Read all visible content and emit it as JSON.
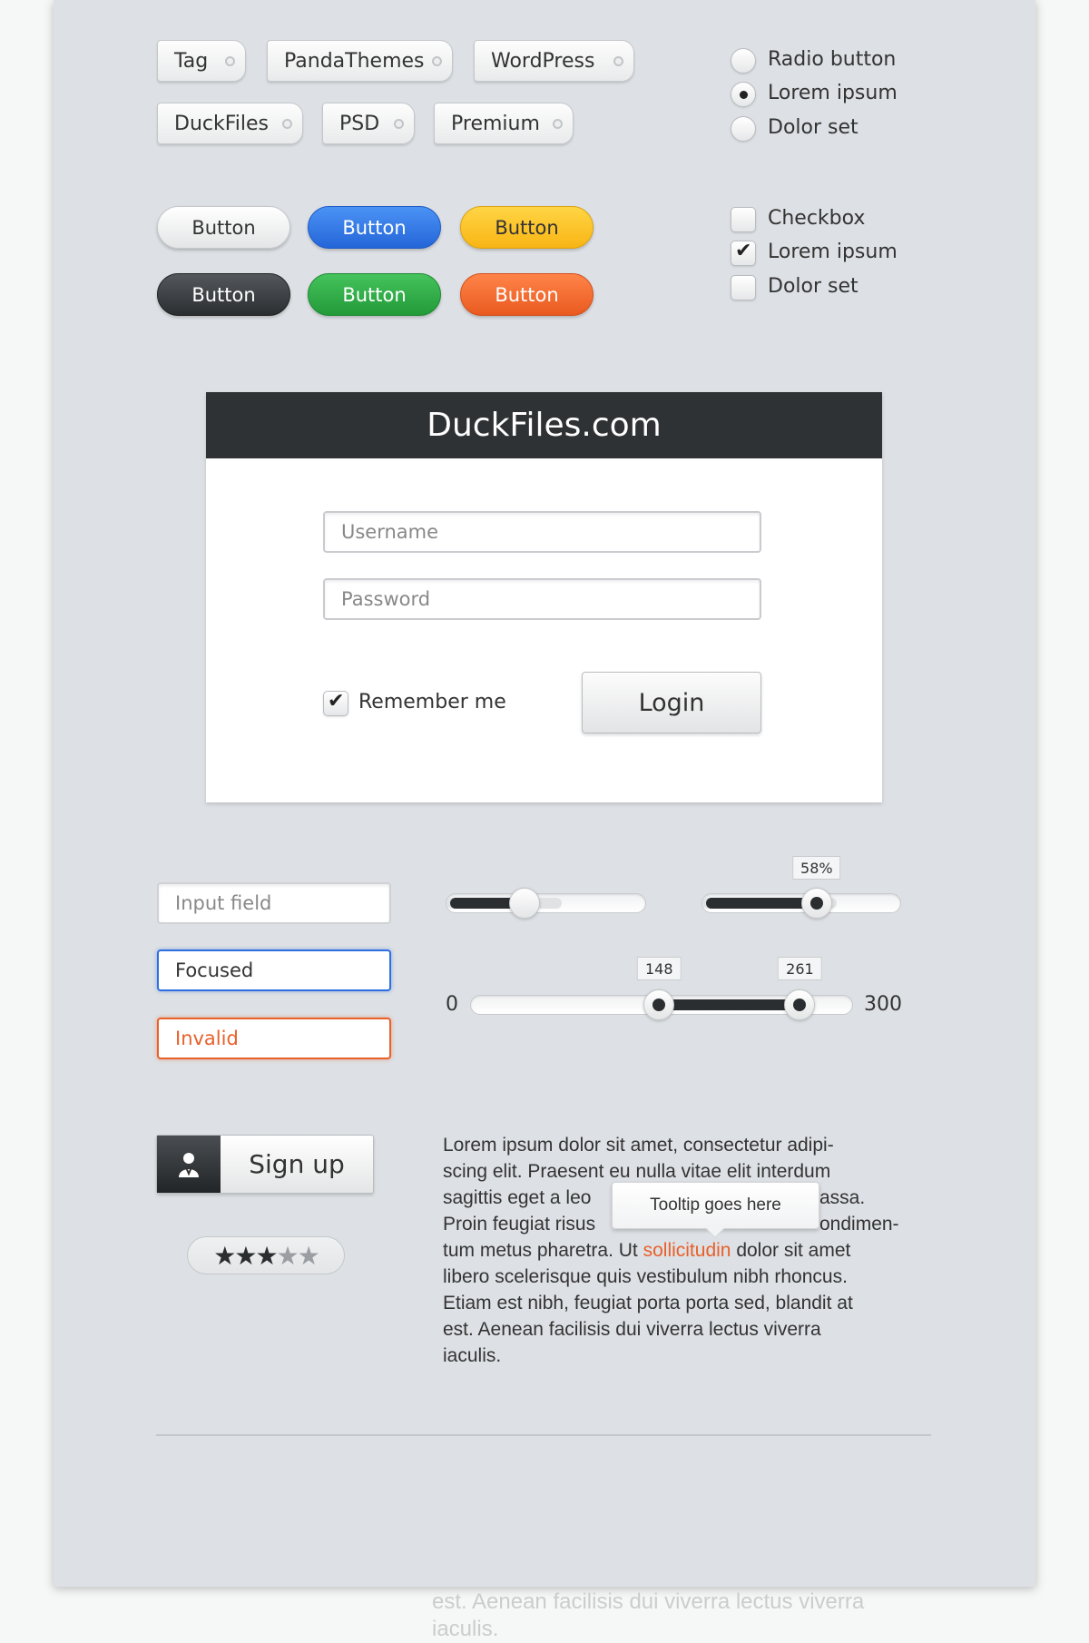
{
  "tags": [
    "Tag",
    "PandaThemes",
    "WordPress",
    "DuckFiles",
    "PSD",
    "Premium"
  ],
  "radios": {
    "items": [
      "Radio button",
      "Lorem ipsum",
      "Dolor set"
    ],
    "selected": 1
  },
  "checkboxes": {
    "items": [
      "Checkbox",
      "Lorem ipsum",
      "Dolor set"
    ],
    "checked": [
      false,
      true,
      false
    ]
  },
  "buttons": [
    {
      "label": "Button",
      "color": "#f2f2f2"
    },
    {
      "label": "Button",
      "color": "#2f7be8"
    },
    {
      "label": "Button",
      "color": "#fcc52a"
    },
    {
      "label": "Button",
      "color": "#3a3d40"
    },
    {
      "label": "Button",
      "color": "#2eac45"
    },
    {
      "label": "Button",
      "color": "#f2692a"
    }
  ],
  "login": {
    "title": "DuckFiles.com",
    "username_placeholder": "Username",
    "password_placeholder": "Password",
    "remember_label": "Remember me",
    "remember_checked": true,
    "login_label": "Login"
  },
  "inputs": {
    "default_placeholder": "Input field",
    "focused_value": "Focused",
    "invalid_value": "Invalid",
    "focus_color": "#2f6fe0",
    "invalid_color": "#e8602a"
  },
  "sliders": {
    "slider1_percent": 39,
    "slider2_percent": 58,
    "slider2_label": "58%",
    "range": {
      "min_label": "0",
      "max_label": "300",
      "min": 0,
      "max": 300,
      "low": 148,
      "high": 261,
      "low_label": "148",
      "high_label": "261"
    }
  },
  "signup": {
    "label": "Sign up",
    "icon": "user-icon"
  },
  "rating": {
    "value": 3,
    "max": 5
  },
  "paragraph": {
    "lines": [
      "Lorem ipsum dolor sit amet, consectetur adipi-",
      "scing elit. Praesent eu nulla vitae elit interdum"
    ],
    "line3_left": "sagittis eget a leo",
    "line3_right": "assa.",
    "line4_left": "Proin feugiat risus",
    "line4_right": "ondimen-",
    "line5_a": "tum metus pharetra. Ut ",
    "line5_link": "sollicitudin",
    "line5_b": " dolor sit amet",
    "rest": [
      "libero scelerisque quis vestibulum nibh rhoncus.",
      "Etiam est nibh, feugiat porta porta sed, blandit at",
      "est. Aenean facilisis dui viverra lectus viverra",
      "iaculis."
    ],
    "link_color": "#e8602a"
  },
  "tooltip": "Tooltip goes here",
  "reflection": [
    "est. Aenean facilisis dui viverra lectus viverra",
    "iaculis."
  ]
}
